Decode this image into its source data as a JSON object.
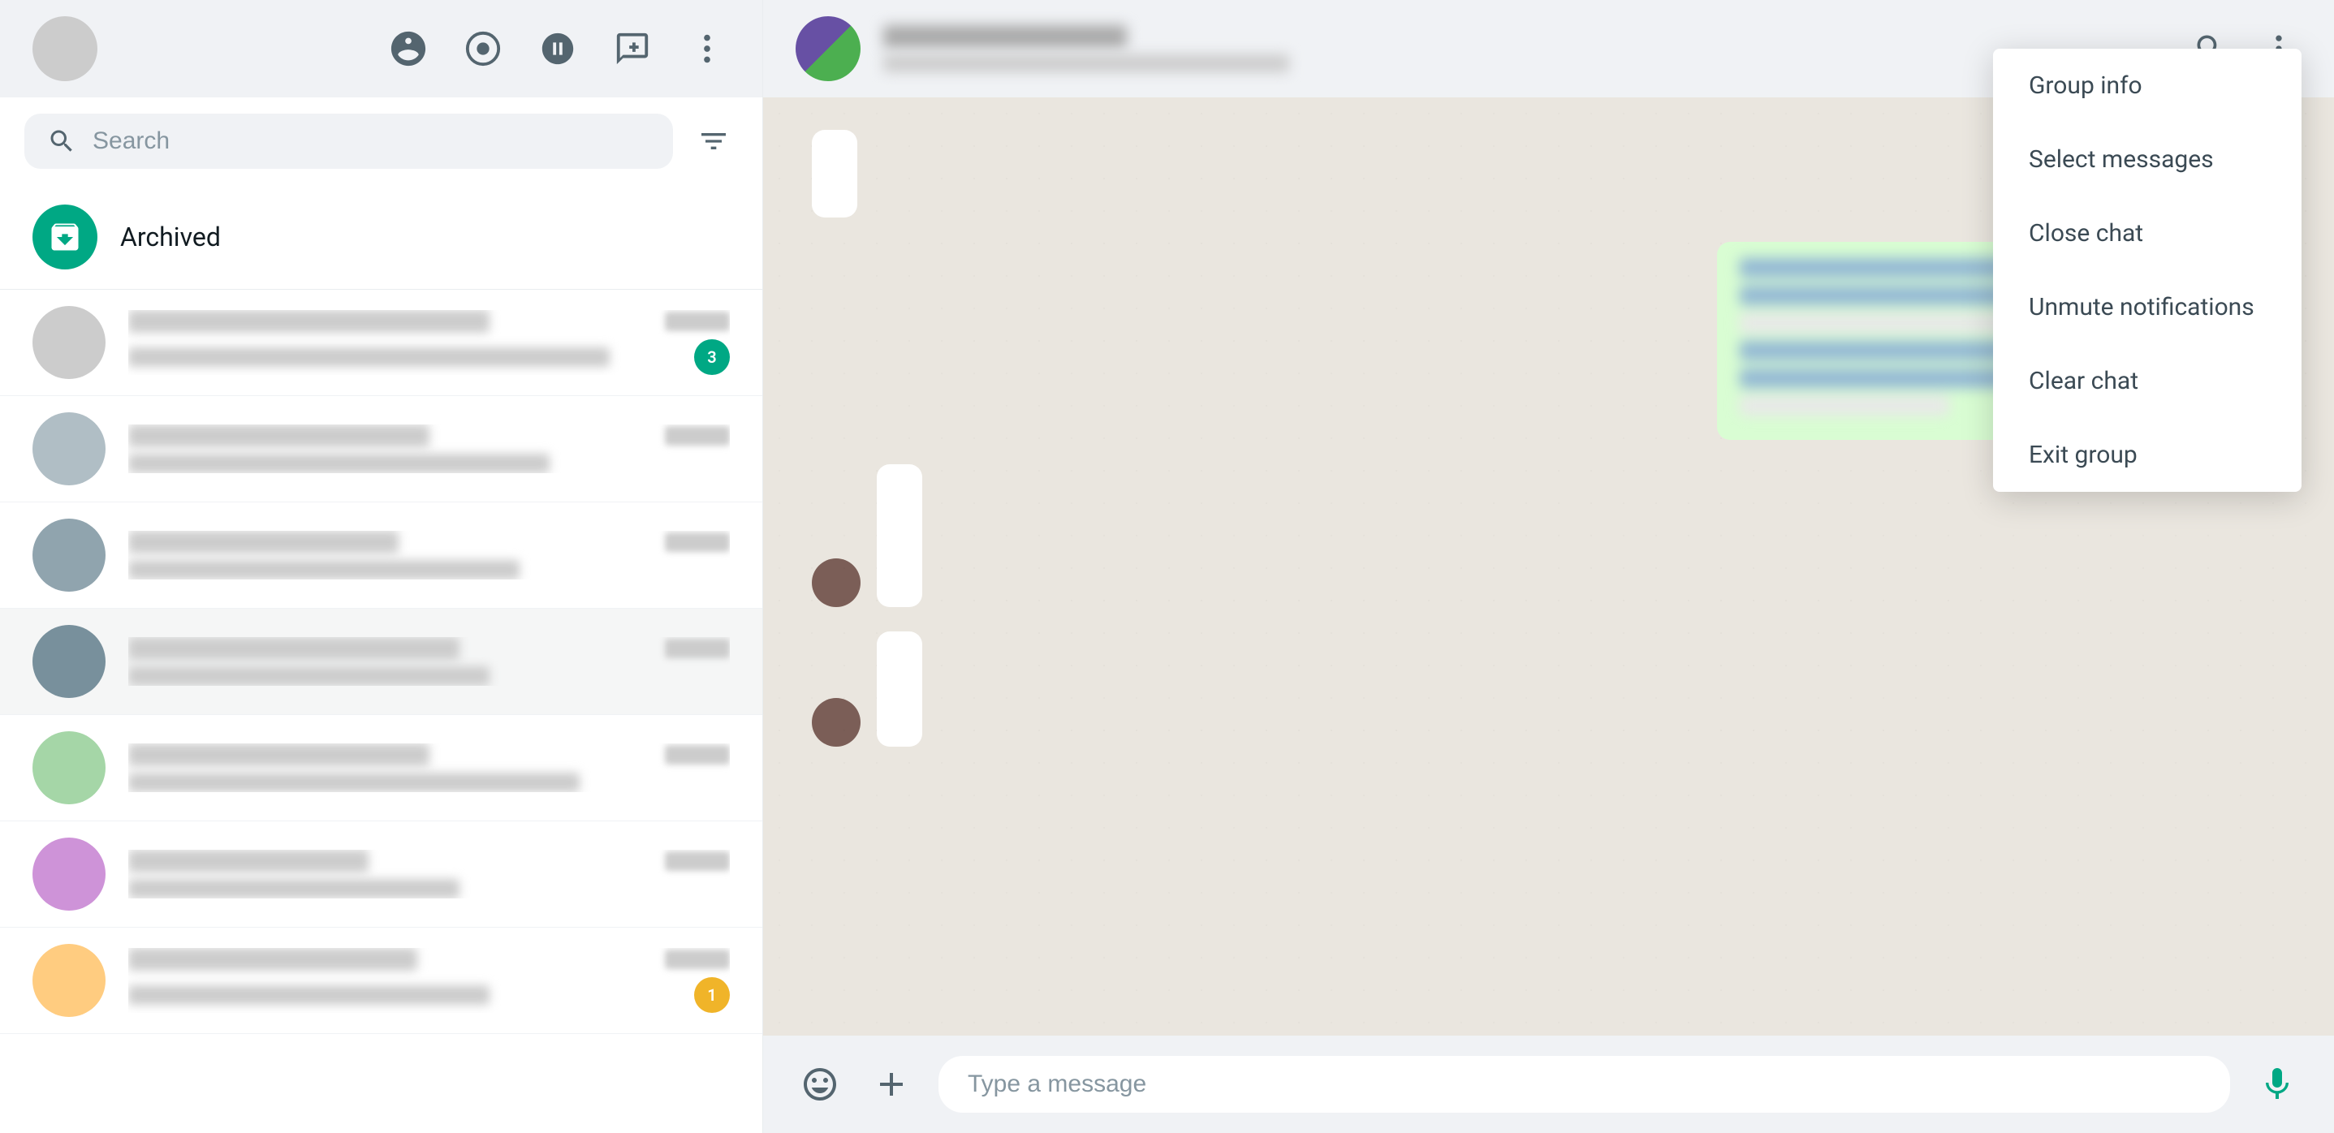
{
  "sidebar": {
    "search": {
      "placeholder": "Search"
    },
    "archived": {
      "label": "Archived"
    },
    "header_icons": [
      {
        "name": "community-icon",
        "label": "Community"
      },
      {
        "name": "status-icon",
        "label": "Status"
      },
      {
        "name": "channels-icon",
        "label": "Channels"
      },
      {
        "name": "new-chat-icon",
        "label": "New chat"
      },
      {
        "name": "menu-icon",
        "label": "Menu"
      }
    ]
  },
  "chat_header": {
    "more_button_label": "More options"
  },
  "chat_footer": {
    "placeholder": "Type a message"
  },
  "dropdown": {
    "items": [
      {
        "label": "Group info",
        "name": "group-info-item"
      },
      {
        "label": "Select messages",
        "name": "select-messages-item"
      },
      {
        "label": "Close chat",
        "name": "close-chat-item"
      },
      {
        "label": "Unmute notifications",
        "name": "unmute-notifications-item"
      },
      {
        "label": "Clear chat",
        "name": "clear-chat-item"
      },
      {
        "label": "Exit group",
        "name": "exit-group-item"
      }
    ]
  },
  "colors": {
    "accent": "#00a884",
    "arrow_red": "#e53935",
    "sidebar_bg": "#f0f2f5",
    "chat_bg": "#eae6df"
  }
}
